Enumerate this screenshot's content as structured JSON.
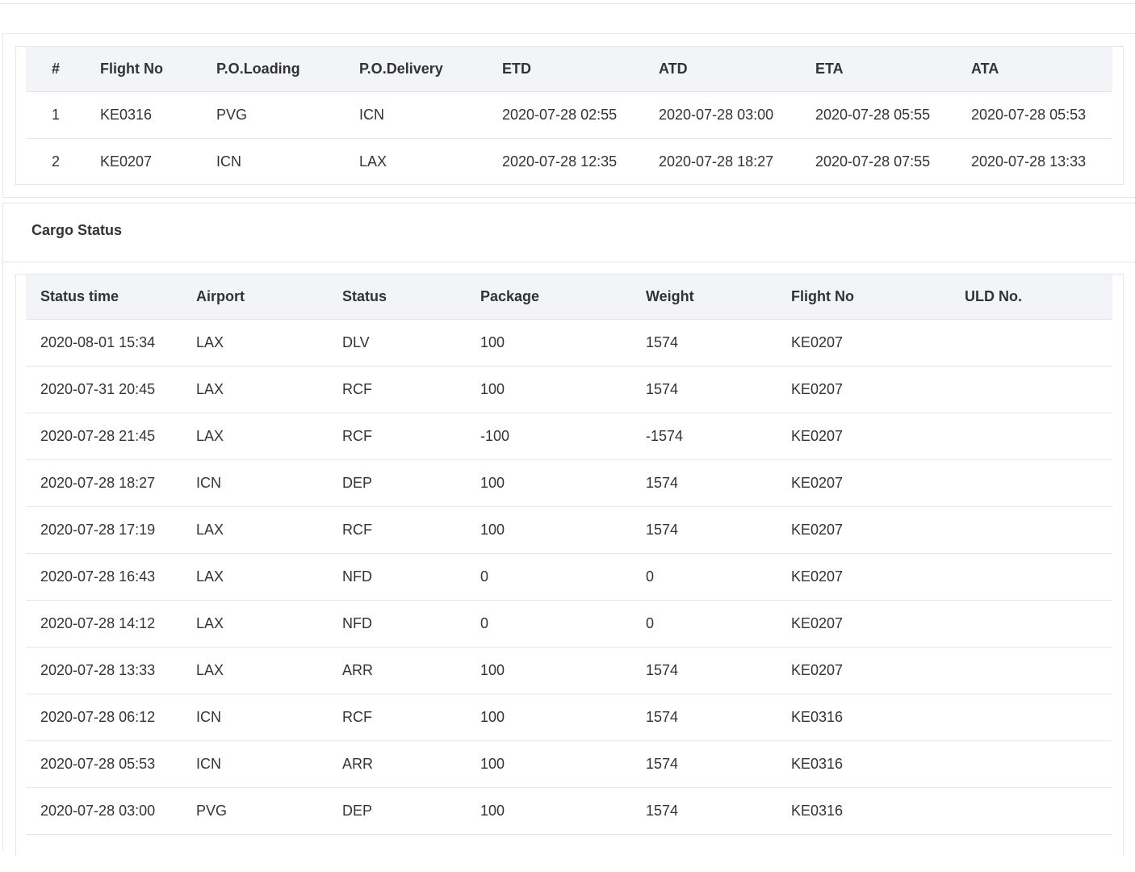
{
  "flights": {
    "headers": [
      "#",
      "Flight No",
      "P.O.Loading",
      "P.O.Delivery",
      "ETD",
      "ATD",
      "ETA",
      "ATA"
    ],
    "rows": [
      [
        "1",
        "KE0316",
        "PVG",
        "ICN",
        "2020-07-28 02:55",
        "2020-07-28 03:00",
        "2020-07-28 05:55",
        "2020-07-28 05:53"
      ],
      [
        "2",
        "KE0207",
        "ICN",
        "LAX",
        "2020-07-28 12:35",
        "2020-07-28 18:27",
        "2020-07-28 07:55",
        "2020-07-28 13:33"
      ]
    ]
  },
  "cargo": {
    "title": "Cargo Status",
    "headers": [
      "Status time",
      "Airport",
      "Status",
      "Package",
      "Weight",
      "Flight No",
      "ULD No."
    ],
    "rows": [
      [
        "2020-08-01 15:34",
        "LAX",
        "DLV",
        "100",
        "1574",
        "KE0207",
        ""
      ],
      [
        "2020-07-31 20:45",
        "LAX",
        "RCF",
        "100",
        "1574",
        "KE0207",
        ""
      ],
      [
        "2020-07-28 21:45",
        "LAX",
        "RCF",
        "-100",
        "-1574",
        "KE0207",
        ""
      ],
      [
        "2020-07-28 18:27",
        "ICN",
        "DEP",
        "100",
        "1574",
        "KE0207",
        ""
      ],
      [
        "2020-07-28 17:19",
        "LAX",
        "RCF",
        "100",
        "1574",
        "KE0207",
        ""
      ],
      [
        "2020-07-28 16:43",
        "LAX",
        "NFD",
        "0",
        "0",
        "KE0207",
        ""
      ],
      [
        "2020-07-28 14:12",
        "LAX",
        "NFD",
        "0",
        "0",
        "KE0207",
        ""
      ],
      [
        "2020-07-28 13:33",
        "LAX",
        "ARR",
        "100",
        "1574",
        "KE0207",
        ""
      ],
      [
        "2020-07-28 06:12",
        "ICN",
        "RCF",
        "100",
        "1574",
        "KE0316",
        ""
      ],
      [
        "2020-07-28 05:53",
        "ICN",
        "ARR",
        "100",
        "1574",
        "KE0316",
        ""
      ],
      [
        "2020-07-28 03:00",
        "PVG",
        "DEP",
        "100",
        "1574",
        "KE0316",
        ""
      ]
    ]
  }
}
